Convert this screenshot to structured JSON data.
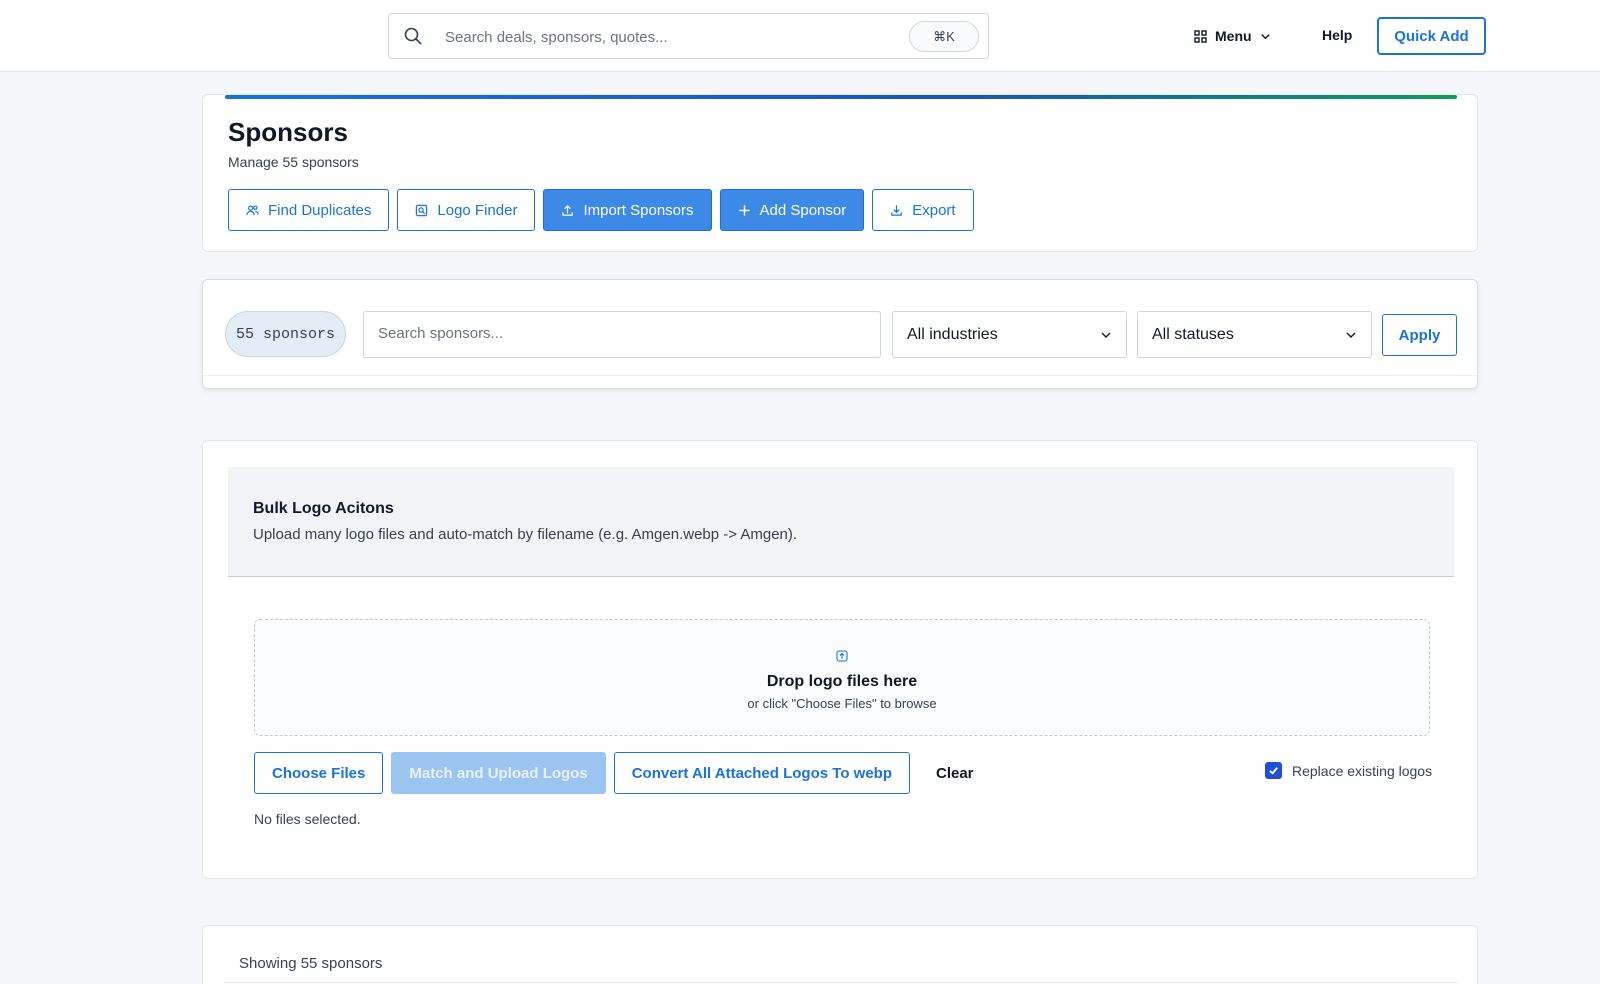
{
  "topbar": {
    "search_placeholder": "Search deals, sponsors, quotes...",
    "shortcut": "⌘K",
    "menu_label": "Menu",
    "help_label": "Help",
    "quick_add_label": "Quick Add"
  },
  "header": {
    "title": "Sponsors",
    "subtitle": "Manage 55 sponsors",
    "buttons": [
      {
        "label": "Find Duplicates",
        "icon": "users-icon"
      },
      {
        "label": "Logo Finder",
        "icon": "image-search-icon"
      },
      {
        "label": "Import Sponsors",
        "icon": "upload-icon"
      },
      {
        "label": "Add Sponsor",
        "icon": "plus-icon"
      },
      {
        "label": "Export",
        "icon": "download-icon"
      }
    ]
  },
  "filters": {
    "count_badge": "55 sponsors",
    "search_placeholder": "Search sponsors...",
    "industry_value": "All industries",
    "status_value": "All statuses",
    "apply_label": "Apply"
  },
  "bulk": {
    "title": "Bulk Logo Acitons",
    "subtitle": "Upload many logo files and auto-match by filename (e.g. Amgen.webp -> Amgen).",
    "drop_title": "Drop logo files here",
    "drop_sub": "or click \"Choose Files\" to browse",
    "choose_files_label": "Choose Files",
    "match_upload_label": "Match and Upload Logos",
    "convert_label": "Convert All Attached Logos To webp",
    "clear_label": "Clear",
    "replace_label": "Replace existing logos",
    "replace_checked": true,
    "files_status": "No files selected."
  },
  "list": {
    "showing_label": "Showing 55 sponsors"
  },
  "colors": {
    "accent": "#1a73d9",
    "primary_button": "#3d8ae6",
    "disabled_button": "#9cc4f1",
    "checkbox": "#1f4fd6"
  }
}
